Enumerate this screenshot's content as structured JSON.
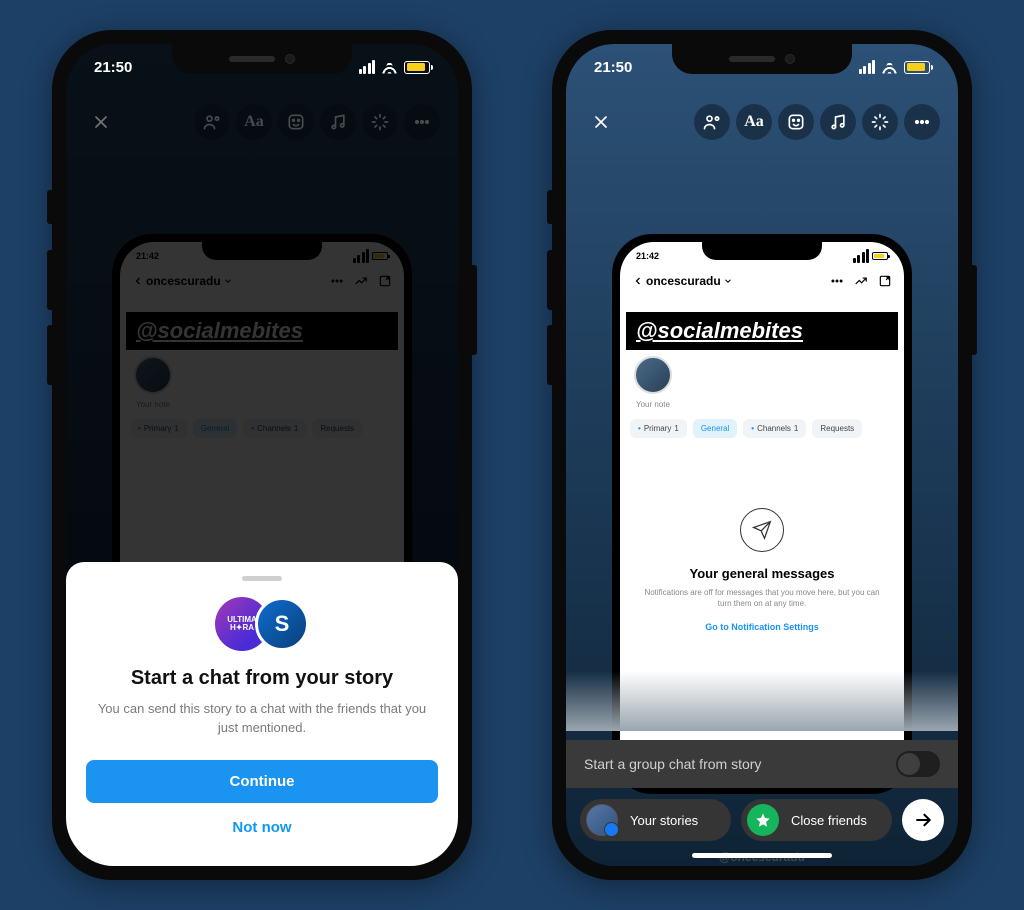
{
  "status": {
    "time": "21:50"
  },
  "innerStatus": {
    "time": "21:42"
  },
  "inner": {
    "back_title": "oncescuradu",
    "mention": "@socialmebites",
    "note": "Your note",
    "tabs": {
      "primary": "Primary",
      "general": "General",
      "channels": "Channels",
      "requests": "Requests",
      "badge": "1"
    },
    "empty": {
      "title": "Your general messages",
      "body": "Notifications are off for messages that you move here, but you can turn them on at any time.",
      "link": "Go to Notification Settings"
    }
  },
  "sheet": {
    "title": "Start a chat from your story",
    "body": "You can send this story to a chat with the friends that you just mentioned.",
    "continue": "Continue",
    "not_now": "Not now"
  },
  "right": {
    "toggle_label": "Start a group chat from story",
    "your_stories": "Your stories",
    "close_friends": "Close friends"
  },
  "watermark": "@oncescuradu"
}
